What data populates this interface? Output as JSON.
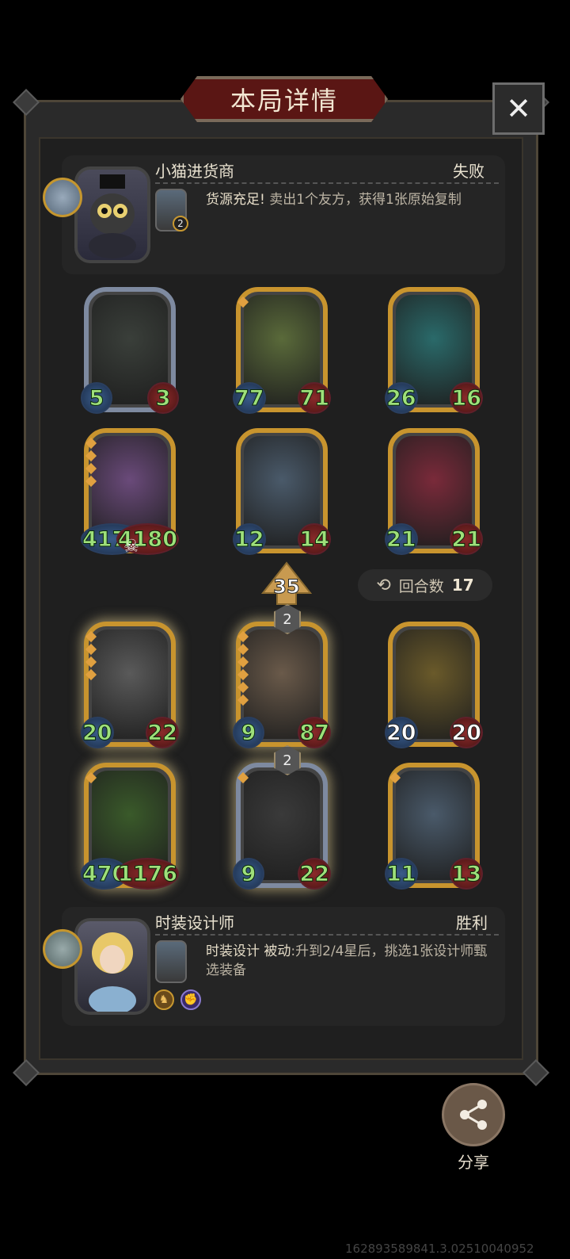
{
  "header": {
    "title": "本局详情",
    "close_label": "✕"
  },
  "opponent": {
    "name": "小猫进货商",
    "result": "失败",
    "skill_badge": "2",
    "skill_title": "货源充足!",
    "skill_desc": "卖出1个友方，获得1张原始复制"
  },
  "opponent_board": [
    {
      "atk": "5",
      "hp": "3",
      "frame": "silver",
      "stars": 0,
      "color": "#3a3f3a"
    },
    {
      "atk": "77",
      "hp": "71",
      "frame": "gold",
      "stars": 1,
      "color": "#5a6a3a"
    },
    {
      "atk": "26",
      "hp": "16",
      "frame": "gold",
      "stars": 0,
      "color": "#2a6a6a"
    },
    {
      "atk": "4178",
      "hp": "4180",
      "frame": "gold",
      "stars": 4,
      "color": "#6a4a7a"
    },
    {
      "atk": "12",
      "hp": "14",
      "frame": "gold",
      "stars": 0,
      "color": "#4a5a6a"
    },
    {
      "atk": "21",
      "hp": "21",
      "frame": "gold",
      "stars": 0,
      "color": "#7a2a3a"
    }
  ],
  "battle": {
    "damage": "35",
    "round_label": "回合数",
    "round_value": "17"
  },
  "player_board": [
    {
      "atk": "20",
      "hp": "22",
      "frame": "gold",
      "stars": 4,
      "color": "#5a5a5a",
      "badge": ""
    },
    {
      "atk": "9",
      "hp": "87",
      "frame": "gold",
      "stars": 6,
      "color": "#6a5a4a",
      "badge": "2"
    },
    {
      "atk": "20",
      "hp": "20",
      "frame": "gold",
      "stars": 0,
      "color": "#6a5a2a",
      "badge": ""
    },
    {
      "atk": "470",
      "hp": "1176",
      "frame": "gold",
      "stars": 1,
      "color": "#3a5a2a",
      "badge": ""
    },
    {
      "atk": "9",
      "hp": "22",
      "frame": "silver",
      "stars": 1,
      "color": "#3a3a3a",
      "badge": "2"
    },
    {
      "atk": "11",
      "hp": "13",
      "frame": "gold",
      "stars": 1,
      "color": "#4a5a6a",
      "badge": ""
    }
  ],
  "player": {
    "name": "时装设计师",
    "result": "胜利",
    "skill_title": "时装设计",
    "skill_tag": "被动",
    "skill_desc": ":升到2/4星后，挑选1张设计师甄选装备"
  },
  "share": {
    "label": "分享"
  },
  "footer": {
    "id_text": "162893589841.3.02510040952"
  }
}
